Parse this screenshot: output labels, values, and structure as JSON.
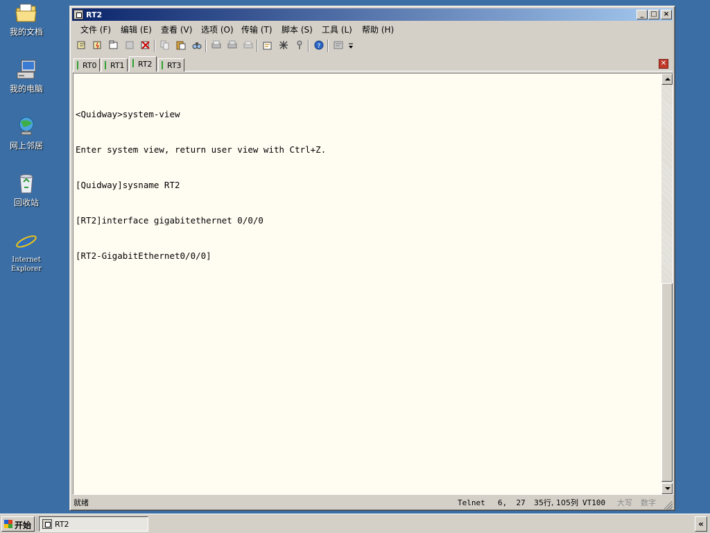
{
  "desktop": {
    "icons": [
      {
        "label": "我的文档",
        "icon": "folder-documents-icon"
      },
      {
        "label": "我的电脑",
        "icon": "computer-icon"
      },
      {
        "label": "网上邻居",
        "icon": "network-icon"
      },
      {
        "label": "回收站",
        "icon": "recycle-bin-icon"
      },
      {
        "label_line1": "Internet",
        "label_line2": "Explorer",
        "icon": "internet-explorer-icon"
      }
    ]
  },
  "window": {
    "title": "RT2",
    "controls": {
      "minimize": "_",
      "maximize": "□",
      "close": "×"
    }
  },
  "menu": [
    {
      "label": "文件 (F)"
    },
    {
      "label": "编辑 (E)"
    },
    {
      "label": "查看 (V)"
    },
    {
      "label": "选项 (O)"
    },
    {
      "label": "传输 (T)"
    },
    {
      "label": "脚本 (S)"
    },
    {
      "label": "工具 (L)"
    },
    {
      "label": "帮助 (H)"
    }
  ],
  "toolbar": {
    "icons": [
      "connect-icon",
      "quick-connect-icon",
      "connect-in-tab-icon",
      "reconnect-icon",
      "disconnect-icon",
      "copy-icon",
      "paste-icon",
      "find-icon",
      "print-icon",
      "print-setup-icon",
      "print-screen-icon",
      "session-options-icon",
      "global-options-icon",
      "keymap-icon",
      "help-icon",
      "chat-window-icon"
    ]
  },
  "tabs": [
    {
      "label": "RT0",
      "active": false
    },
    {
      "label": "RT1",
      "active": false
    },
    {
      "label": "RT2",
      "active": true
    },
    {
      "label": "RT3",
      "active": false
    }
  ],
  "terminal": {
    "lines": [
      "<Quidway>system-view",
      "Enter system view, return user view with Ctrl+Z.",
      "[Quidway]sysname RT2",
      "[RT2]interface gigabitethernet 0/0/0",
      "[RT2-GigabitEthernet0/0/0]"
    ],
    "background": "#fffcf2"
  },
  "status": {
    "ready": "就绪",
    "protocol": "Telnet",
    "cursor": "6,  27",
    "size": "35行, 105列",
    "emulation": "VT100",
    "caps": "大写",
    "num": "数字"
  },
  "taskbar": {
    "start": "开始",
    "task": "RT2",
    "tray_toggle": "«"
  },
  "colors": {
    "desktop": "#3a6ea5",
    "titlebar_start": "#0a246a",
    "titlebar_end": "#a6caf0",
    "tab_mark": "#2fa02f",
    "tab_close": "#c0392b"
  }
}
